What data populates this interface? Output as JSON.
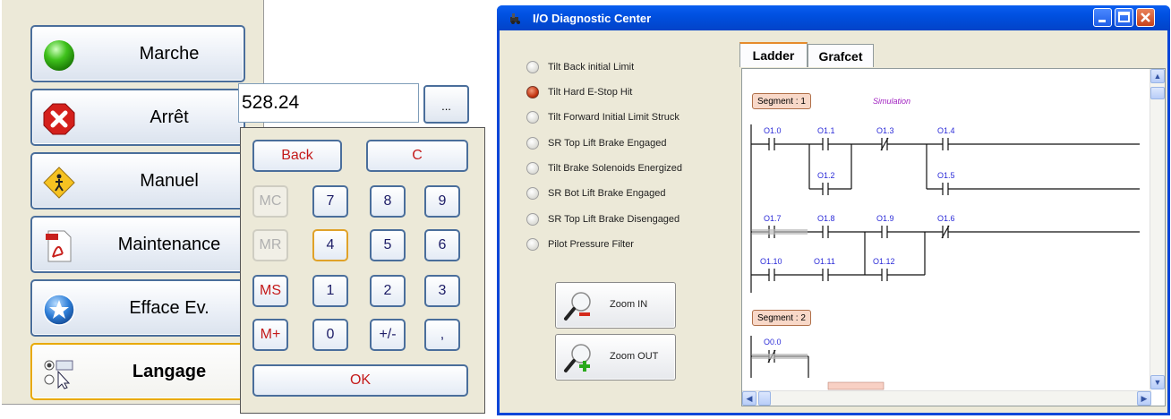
{
  "left_menu": {
    "items": [
      {
        "label": "Marche",
        "icon": "green-circle-icon"
      },
      {
        "label": "Arrêt",
        "icon": "stop-x-icon"
      },
      {
        "label": "Manuel",
        "icon": "pedestrian-sign-icon"
      },
      {
        "label": "Maintenance",
        "icon": "pdf-document-icon"
      },
      {
        "label": "Efface Ev.",
        "icon": "blue-star-icon"
      },
      {
        "label": "Langage",
        "icon": "radio-cursor-icon"
      }
    ],
    "selected": "Langage"
  },
  "calculator": {
    "display_value": "528.24",
    "more_label": "...",
    "keys": {
      "back": "Back",
      "clear": "C",
      "mc": "MC",
      "mr": "MR",
      "ms": "MS",
      "mplus": "M+",
      "k7": "7",
      "k8": "8",
      "k9": "9",
      "k4": "4",
      "k5": "5",
      "k6": "6",
      "k1": "1",
      "k2": "2",
      "k3": "3",
      "k0": "0",
      "sign": "+/-",
      "dot": ",",
      "ok": "OK"
    }
  },
  "diag_window": {
    "title": "I/O Diagnostic Center",
    "status_items": [
      {
        "label": "Tilt Back initial Limit",
        "on": false
      },
      {
        "label": "Tilt Hard E-Stop Hit",
        "on": true
      },
      {
        "label": "Tilt Forward Initial Limit Struck",
        "on": false
      },
      {
        "label": "SR Top Lift Brake Engaged",
        "on": false
      },
      {
        "label": "Tilt Brake Solenoids Energized",
        "on": false
      },
      {
        "label": "SR Bot Lift Brake Engaged",
        "on": false
      },
      {
        "label": "SR Top Lift Brake Disengaged",
        "on": false
      },
      {
        "label": "Pilot Pressure Filter",
        "on": false
      }
    ],
    "zoom_in": "Zoom IN",
    "zoom_out": "Zoom OUT",
    "tabs": [
      "Ladder",
      "Grafcet"
    ],
    "active_tab": "Ladder",
    "ladder": {
      "segment1": "Segment : 1",
      "segment2": "Segment : 2",
      "simulation": "Simulation",
      "contacts": {
        "c1": "O1.0",
        "c2": "O1.1",
        "c3": "O1.3",
        "c4": "O1.4",
        "c5": "O1.2",
        "c6": "O1.5",
        "c7": "O1.7",
        "c8": "O1.8",
        "c9": "O1.9",
        "c10": "O1.6",
        "c11": "O1.10",
        "c12": "O1.11",
        "c13": "O1.12",
        "c14": "O0.0"
      }
    }
  }
}
